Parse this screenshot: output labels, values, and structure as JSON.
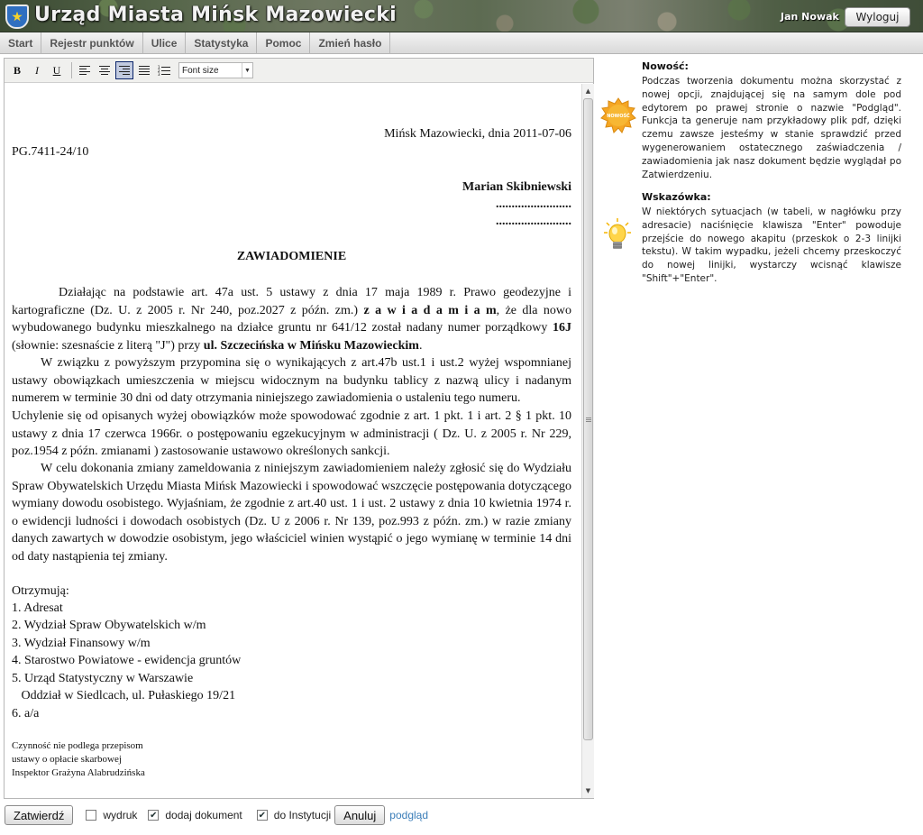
{
  "header": {
    "title": "Urząd Miasta Mińsk Mazowiecki",
    "user": "Jan Nowak",
    "logout_label": "Wyloguj",
    "logo_icon": "city-crest-icon"
  },
  "nav": {
    "items": [
      "Start",
      "Rejestr punktów",
      "Ulice",
      "Statystyka",
      "Pomoc",
      "Zmień hasło"
    ]
  },
  "toolbar": {
    "bold": "B",
    "italic": "I",
    "underline": "U",
    "font_size_label": "Font size",
    "active_align": "align-right",
    "icons": [
      "bold-icon",
      "italic-icon",
      "underline-icon",
      "align-left-icon",
      "align-center-icon",
      "align-right-icon",
      "align-justify-icon",
      "numbered-list-icon"
    ]
  },
  "document": {
    "place_date": "Mińsk Mazowiecki, dnia 2011-07-06",
    "ref": "PG.7411-24/10",
    "addressee": "Marian Skibniewski",
    "dots1": "........................",
    "dots2": "........................",
    "heading": "ZAWIADOMIENIE",
    "p1_a": "Działając na podstawie art. 47a ust. 5 ustawy z dnia 17 maja 1989 r. Prawo geodezyjne i kartograficzne (Dz. U. z 2005 r. Nr 240, poz.2027 z późn. zm.) ",
    "p1_b": "z a w i a d a m i a m",
    "p1_c": ", że dla nowo wybudowanego budynku mieszkalnego na działce gruntu nr 641/12 został nadany numer porządkowy ",
    "p1_d": "16J",
    "p1_e": " (słownie: szesnaście z literą \"J\") przy ",
    "p1_f": "ul. Szczecińska w Mińsku Mazowieckim",
    "p1_g": ".",
    "p2": "W związku z powyższym przypomina się o wynikających z art.47b ust.1 i ust.2 wyżej wspomnianej ustawy obowiązkach umieszczenia w miejscu widocznym na budynku tablicy z nazwą ulicy i nadanym numerem w terminie 30 dni od daty otrzymania niniejszego zawiadomienia o ustaleniu tego numeru.",
    "p3": "Uchylenie się od opisanych wyżej obowiązków może spowodować zgodnie z art. 1 pkt. 1 i art. 2 § 1 pkt. 10 ustawy z dnia 17 czerwca 1966r. o postępowaniu egzekucyjnym w administracji ( Dz. U. z 2005 r. Nr 229, poz.1954 z późn. zmianami ) zastosowanie ustawowo określonych sankcji.",
    "p4": "W celu dokonania zmiany zameldowania z niniejszym zawiadomieniem należy zgłosić się do Wydziału Spraw Obywatelskich Urzędu Miasta Mińsk Mazowiecki i spowodować wszczęcie postępowania dotyczącego wymiany dowodu osobistego. Wyjaśniam, że zgodnie z art.40 ust. 1 i ust. 2 ustawy z dnia 10 kwietnia 1974 r. o ewidencji ludności i dowodach osobistych (Dz. U z 2006 r. Nr 139, poz.993 z późn. zm.) w razie zmiany danych zawartych w dowodzie osobistym, jego właściciel winien wystąpić o jego wymianę w terminie 14 dni od daty nastąpienia tej zmiany.",
    "recipients_label": "Otrzymują:",
    "recipients": [
      "1. Adresat",
      "2. Wydział Spraw Obywatelskich w/m",
      "3. Wydział Finansowy w/m",
      "4. Starostwo Powiatowe - ewidencja gruntów",
      "5. Urząd Statystyczny w Warszawie",
      "   Oddział w Siedlcach, ul. Pułaskiego 19/21",
      "6. a/a"
    ],
    "footnote": [
      "Czynność nie podlega przepisom",
      "ustawy o opłacie skarbowej",
      "Inspektor Grażyna Alabrudzińska"
    ]
  },
  "actions": {
    "approve_label": "Zatwierdź",
    "print_label": "wydruk",
    "print_checked": false,
    "add_doc_label": "dodaj dokument",
    "add_doc_checked": true,
    "institution_label": "do Instytucji",
    "institution_checked": true,
    "cancel_label": "Anuluj",
    "preview_label": "podgląd",
    "link_color": "#3a7db8"
  },
  "side": {
    "news_title": "Nowość:",
    "news_badge": "NOWOŚĆ",
    "news_text": "Podczas tworzenia dokumentu można skorzystać z nowej opcji, znajdującej się na samym dole pod edytorem po prawej stronie o nazwie \"Podgląd\". Funkcja ta generuje nam przykładowy plik pdf, dzięki czemu zawsze jesteśmy w stanie sprawdzić przed wygenerowaniem ostatecznego zaświadczenia / zawiadomienia jak nasz dokument będzie wyglądał po Zatwierdzeniu.",
    "hint_title": "Wskazówka:",
    "hint_text": "W niektórych sytuacjach (w tabeli, w nagłówku przy adresacie) naciśnięcie klawisza \"Enter\" powoduje przejście do nowego akapitu (przeskok o 2-3 linijki tekstu). W takim wypadku, jeżeli chcemy przeskoczyć do nowej linijki, wystarczy wcisnąć klawisze \"Shift\"+\"Enter\".",
    "news_icon": "new-badge-icon",
    "hint_icon": "lightbulb-icon"
  }
}
